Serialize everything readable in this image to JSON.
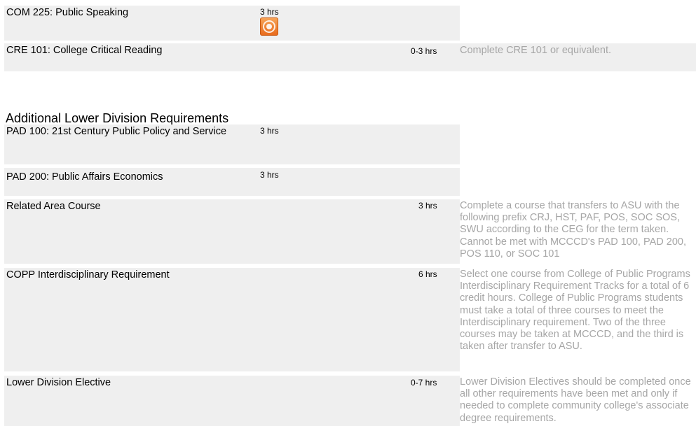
{
  "rows": [
    {
      "course": "COM 225: Public Speaking",
      "hours": "3 hrs",
      "icon": "audio-play-icon"
    },
    {
      "course": "CRE 101: College Critical Reading",
      "hours": "0-3 hrs",
      "note": "Complete CRE 101 or equivalent."
    },
    {
      "course": "PAD 100: 21st Century Public Policy and Service",
      "hours": "3 hrs"
    },
    {
      "course": "PAD 200: Public Affairs Economics",
      "hours": "3 hrs"
    },
    {
      "course": "Related Area Course",
      "hours": "3 hrs",
      "note": "Complete a course that transfers to ASU with the following prefix CRJ, HST, PAF, POS, SOC SOS, SWU according to the CEG for the term taken. Cannot be met with MCCCD's PAD 100, PAD 200, POS 110, or SOC 101"
    },
    {
      "course": "COPP Interdisciplinary Requirement",
      "hours": "6 hrs",
      "note": "Select one course from College of Public Programs Interdisciplinary Requirement Tracks for a total of 6 credit hours. College of Public Programs students must take a total of three courses to meet the Interdisciplinary requirement. Two of the three courses may be taken at MCCCD, and the third is taken after transfer to ASU."
    },
    {
      "course": "Lower Division Elective",
      "hours": "0-7 hrs",
      "note": "Lower Division Electives should be completed once all other requirements have been met and only if needed to complete community college's associate degree requirements."
    }
  ],
  "section_title": "Additional Lower Division Requirements",
  "colors": {
    "row_bg": "#efefef",
    "note_text": "#a6a6a6",
    "badge": "#e8691a"
  }
}
